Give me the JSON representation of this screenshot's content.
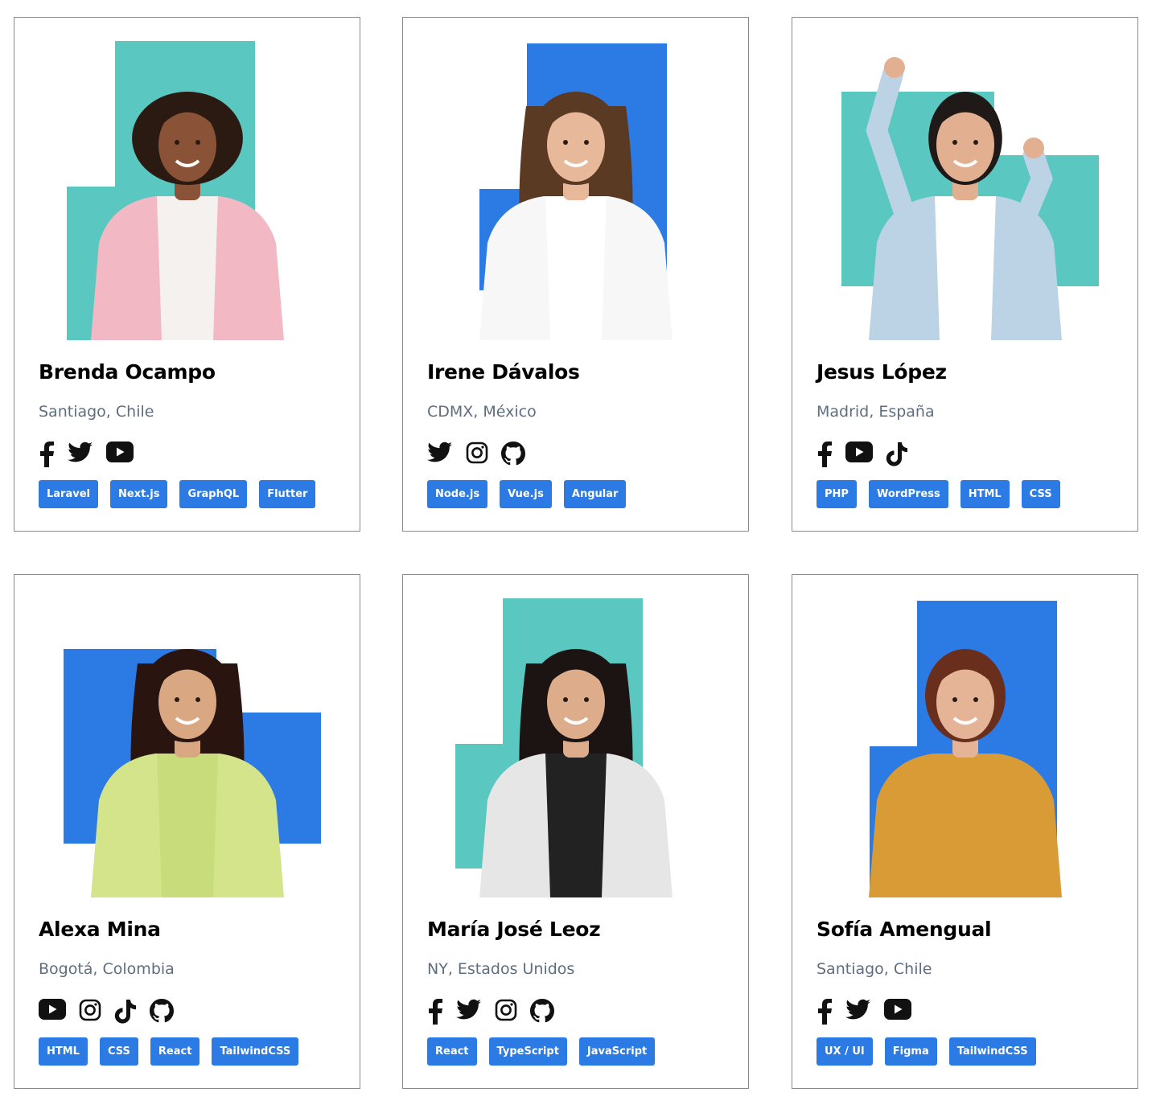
{
  "brand_colors": {
    "teal": "#5bc7c1",
    "blue": "#2c7be5",
    "text_muted": "#5f6e7f"
  },
  "cards": [
    {
      "name": "Brenda Ocampo",
      "location": "Santiago, Chile",
      "socials": [
        "facebook-icon",
        "twitter-icon",
        "youtube-icon"
      ],
      "tags": [
        "Laravel",
        "Next.js",
        "GraphQL",
        "Flutter"
      ]
    },
    {
      "name": "Irene Dávalos",
      "location": "CDMX, México",
      "socials": [
        "twitter-icon",
        "instagram-icon",
        "github-icon"
      ],
      "tags": [
        "Node.js",
        "Vue.js",
        "Angular"
      ]
    },
    {
      "name": "Jesus López",
      "location": "Madrid, España",
      "socials": [
        "facebook-icon",
        "youtube-icon",
        "tiktok-icon"
      ],
      "tags": [
        "PHP",
        "WordPress",
        "HTML",
        "CSS"
      ]
    },
    {
      "name": "Alexa Mina",
      "location": "Bogotá, Colombia",
      "socials": [
        "youtube-icon",
        "instagram-icon",
        "tiktok-icon",
        "github-icon"
      ],
      "tags": [
        "HTML",
        "CSS",
        "React",
        "TailwindCSS"
      ]
    },
    {
      "name": "María José Leoz",
      "location": "NY, Estados Unidos",
      "socials": [
        "facebook-icon",
        "twitter-icon",
        "instagram-icon",
        "github-icon"
      ],
      "tags": [
        "React",
        "TypeScript",
        "JavaScript"
      ]
    },
    {
      "name": "Sofía Amengual",
      "location": "Santiago, Chile",
      "socials": [
        "facebook-icon",
        "twitter-icon",
        "youtube-icon"
      ],
      "tags": [
        "UX / UI",
        "Figma",
        "TailwindCSS"
      ]
    }
  ]
}
